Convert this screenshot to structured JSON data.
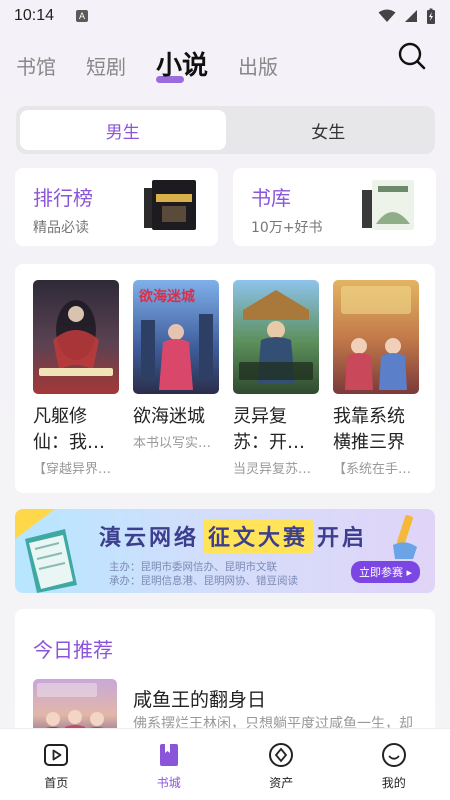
{
  "status": {
    "time": "10:14",
    "notif_letter": "A"
  },
  "top_tabs": [
    {
      "label": "书馆",
      "active": false
    },
    {
      "label": "短剧",
      "active": false
    },
    {
      "label": "小说",
      "active": true
    },
    {
      "label": "出版",
      "active": false
    }
  ],
  "gender_tabs": [
    {
      "label": "男生",
      "active": true
    },
    {
      "label": "女生",
      "active": false
    }
  ],
  "quick_cards": {
    "rank": {
      "title": "排行榜",
      "subtitle": "精品必读"
    },
    "library": {
      "title": "书库",
      "subtitle": "10万+好书"
    }
  },
  "books": [
    {
      "title": "凡躯修仙：我…",
      "desc": "【穿越异界…",
      "cover_text": "凡躯修仙",
      "cover_colors": [
        "#3a2f45",
        "#b23a3a"
      ]
    },
    {
      "title": "欲海迷城",
      "desc": "本书以写实…",
      "cover_text": "欲海迷城",
      "cover_colors": [
        "#5d8fd6",
        "#d9486a"
      ]
    },
    {
      "title": "灵异复苏：开…",
      "desc": "当灵异复苏…",
      "cover_text": "开局继承城隍庙",
      "cover_colors": [
        "#6aa3d8",
        "#3f7a3a"
      ]
    },
    {
      "title": "我靠系统横推三界",
      "desc": "【系统在手…",
      "cover_text": "我靠系统横推三界",
      "cover_colors": [
        "#cc9444",
        "#c4525b"
      ]
    }
  ],
  "banner": {
    "headline_left": "滇云网络",
    "headline_highlight": "征文大赛",
    "headline_right": "开启",
    "line1": "主办：昆明市委网信办、昆明市文联",
    "line2": "承办：昆明信息港、昆明网协、错豆阅读",
    "cta": "立即参赛 ▸"
  },
  "today": {
    "section_title": "今日推荐",
    "book_title": "咸鱼王的翻身日",
    "book_desc": "佛系摆烂王林闲，只想躺平度过咸鱼一生，却",
    "cover_text": "咸鱼王的翻身日"
  },
  "nav": [
    {
      "label": "首页",
      "icon": "play-icon",
      "active": false
    },
    {
      "label": "书城",
      "icon": "book-icon",
      "active": true
    },
    {
      "label": "资产",
      "icon": "diamond-icon",
      "active": false
    },
    {
      "label": "我的",
      "icon": "smile-icon",
      "active": false
    }
  ],
  "colors": {
    "accent": "#8b55d9",
    "banner_button": "#7b46e3"
  }
}
